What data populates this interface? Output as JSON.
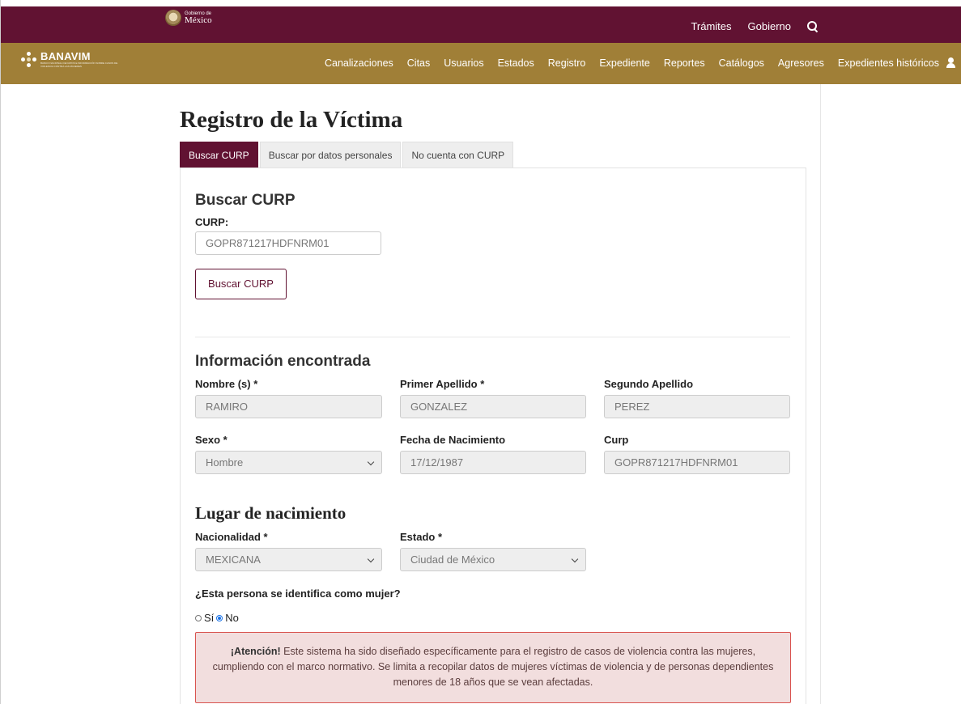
{
  "header": {
    "gov_logo_small": "Gobierno de",
    "gov_logo_big": "México",
    "top_links": [
      "Trámites",
      "Gobierno"
    ]
  },
  "navbar": {
    "brand_name": "BANAVIM",
    "brand_sub": "BANCO NACIONAL DE DATOS E INFORMACIÓN SOBRE CASOS DE VIOLENCIA CONTRA LAS MUJERES",
    "items": [
      "Canalizaciones",
      "Citas",
      "Usuarios",
      "Estados",
      "Registro",
      "Expediente",
      "Reportes",
      "Catálogos",
      "Agresores",
      "Expedientes históricos"
    ]
  },
  "page": {
    "title": "Registro de la Víctima",
    "tabs": [
      "Buscar CURP",
      "Buscar por datos personales",
      "No cuenta con CURP"
    ]
  },
  "buscar": {
    "title": "Buscar CURP",
    "curp_label": "CURP:",
    "curp_value": "GOPR871217HDFNRM01",
    "button": "Buscar CURP"
  },
  "info": {
    "title": "Información encontrada",
    "nombre_label": "Nombre (s) *",
    "nombre_value": "RAMIRO",
    "ap1_label": "Primer Apellido *",
    "ap1_value": "GONZALEZ",
    "ap2_label": "Segundo Apellido",
    "ap2_value": "PEREZ",
    "sexo_label": "Sexo *",
    "sexo_value": "Hombre",
    "fecha_label": "Fecha de Nacimiento",
    "fecha_value": "17/12/1987",
    "curp_label": "Curp",
    "curp_value": "GOPR871217HDFNRM01"
  },
  "nacimiento": {
    "title": "Lugar de nacimiento",
    "nacionalidad_label": "Nacionalidad *",
    "nacionalidad_value": "MEXICANA",
    "estado_label": "Estado *",
    "estado_value": "Ciudad de México"
  },
  "mujer": {
    "question": "¿Esta persona se identifica como mujer?",
    "opt_si": "Sí",
    "opt_no": "No",
    "selected": "No"
  },
  "alert": {
    "strong": "¡Atención!",
    "text": " Este sistema ha sido diseñado específicamente para el registro de casos de violencia contra las mujeres, cumpliendo con el marco normativo. Se limita a recopilar datos de mujeres víctimas de violencia y de personas dependientes menores de 18 años que se vean afectadas."
  },
  "colors": {
    "guinda": "#611232",
    "dorado": "#a07f37",
    "alert_bg": "#f2dede",
    "alert_border": "#d9534f"
  }
}
